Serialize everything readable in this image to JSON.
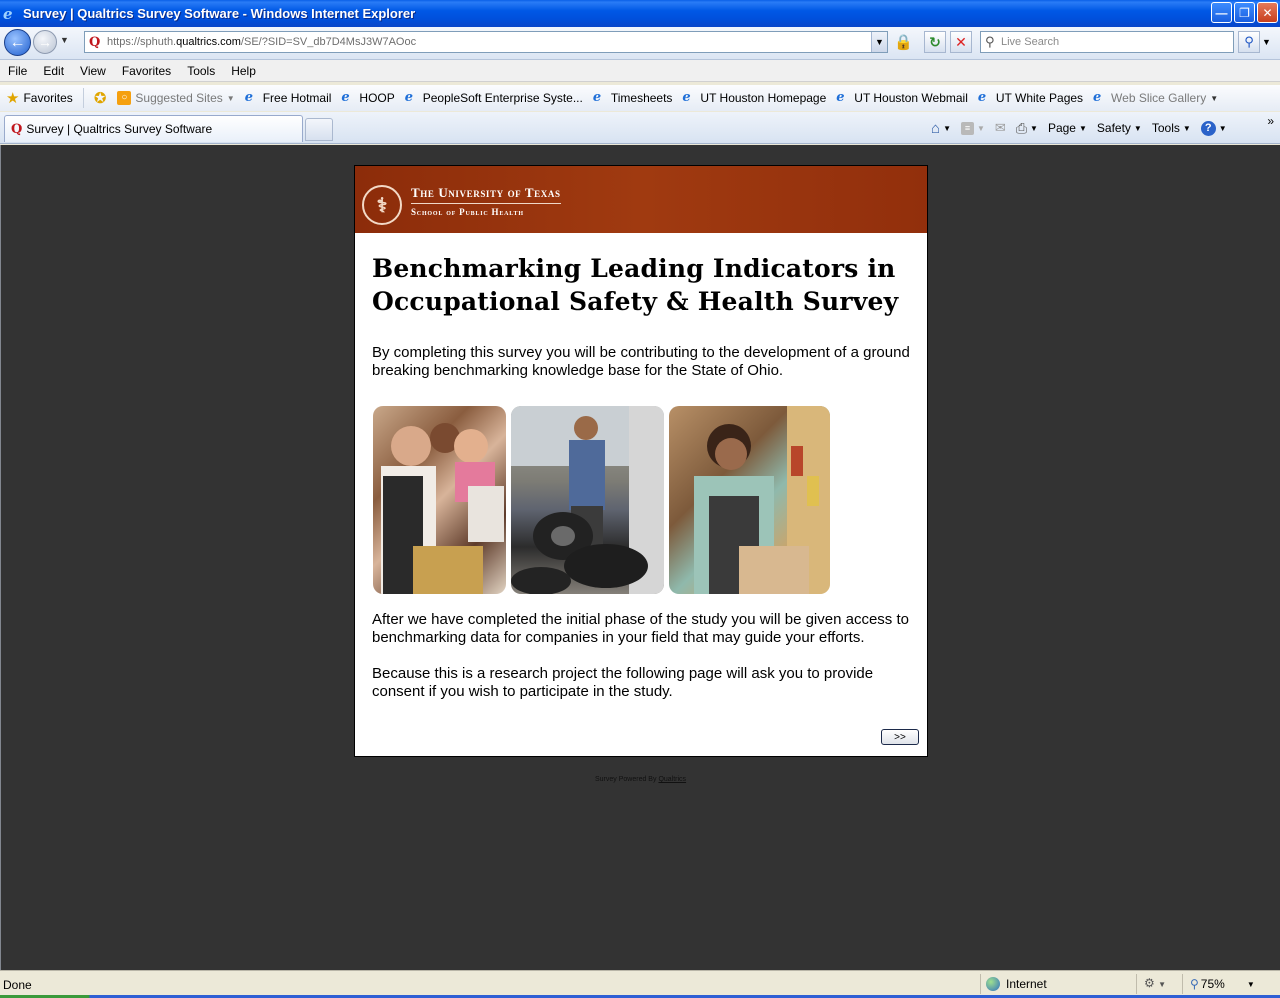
{
  "window": {
    "title": "Survey | Qualtrics Survey Software - Windows Internet Explorer"
  },
  "nav": {
    "url_prefix": "https://",
    "url_host_pre": "sphuth.",
    "url_host_main": "qualtrics.com",
    "url_path": "/SE/?SID=SV_db7D4MsJ3W7AOoc",
    "search_placeholder": "Live Search"
  },
  "menu": [
    "File",
    "Edit",
    "View",
    "Favorites",
    "Tools",
    "Help"
  ],
  "favorites": {
    "label": "Favorites",
    "items": [
      {
        "label": "Suggested Sites",
        "dim": true
      },
      {
        "label": "Free Hotmail"
      },
      {
        "label": "HOOP"
      },
      {
        "label": "PeopleSoft Enterprise Syste..."
      },
      {
        "label": "Timesheets"
      },
      {
        "label": "UT Houston Homepage"
      },
      {
        "label": "UT Houston Webmail"
      },
      {
        "label": "UT White Pages"
      },
      {
        "label": "Web Slice Gallery",
        "dim": true
      }
    ]
  },
  "tabs": {
    "active_label": "Survey | Qualtrics Survey Software"
  },
  "commandbar": {
    "page": "Page",
    "safety": "Safety",
    "tools": "Tools"
  },
  "banner": {
    "university": "The University of Texas",
    "school": "School of Public Health"
  },
  "survey": {
    "title": "Benchmarking Leading Indicators in Occupational Safety & Health Survey",
    "intro": "By completing this survey you will be contributing to the development of a ground breaking benchmarking knowledge base for the State of Ohio.",
    "para2": "After we have completed the initial phase of the study you will be given access to benchmarking data for companies in your field that may guide your efforts.",
    "para3": "Because this is a research project the following page will ask you to provide consent if you wish to participate in the study.",
    "next_label": ">>"
  },
  "footer": {
    "powered_prefix": "Survey Powered By",
    "powered_link": "Qualtrics"
  },
  "status": {
    "text": "Done",
    "zone": "Internet",
    "zoom": "75%"
  },
  "colors": {
    "banner": "#983510",
    "page_bg": "#333333",
    "titlebar": "#0058e6"
  }
}
